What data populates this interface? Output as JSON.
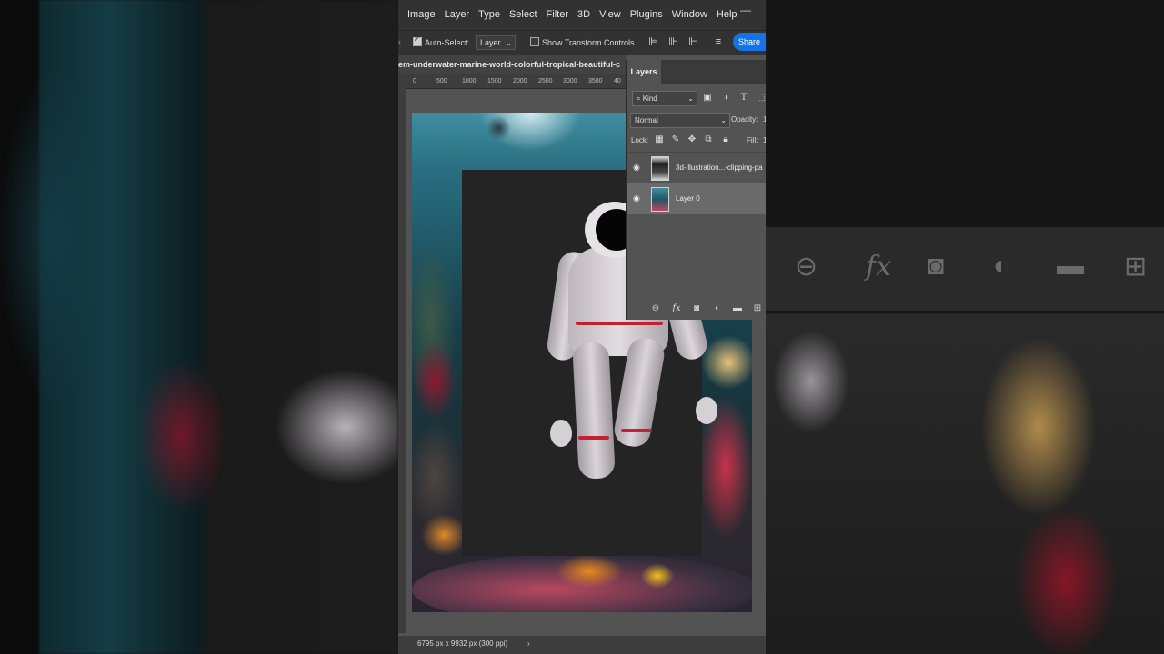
{
  "menu": [
    "Image",
    "Layer",
    "Type",
    "Select",
    "Filter",
    "3D",
    "View",
    "Plugins",
    "Window",
    "Help"
  ],
  "options_bar": {
    "auto_select_label": "Auto-Select:",
    "auto_select_checked": true,
    "target_value": "Layer",
    "transform_label": "Show Transform Controls",
    "transform_checked": false,
    "share_label": "Share"
  },
  "document_tab": "em-underwater-marine-world-colorful-tropical-beautiful-c",
  "ruler_ticks": [
    "0",
    "500",
    "1000",
    "1500",
    "2000",
    "2500",
    "3000",
    "3500",
    "40"
  ],
  "layers_panel": {
    "tab_label": "Layers",
    "kind_value": "Kind",
    "blend_mode": "Normal",
    "opacity_label": "Opacity:",
    "opacity_value": "1",
    "lock_label": "Lock:",
    "fill_label": "Fill:",
    "fill_value": "1",
    "layers": [
      {
        "name": "3d-illustration...-clipping-pa",
        "visible": true,
        "active": false
      },
      {
        "name": "Layer 0",
        "visible": true,
        "active": true
      }
    ]
  },
  "status_bar": {
    "doc_size": "6795 px x 9932 px (300 ppi)",
    "arrow": "›"
  },
  "icons": {
    "accent": "#1473e6"
  }
}
